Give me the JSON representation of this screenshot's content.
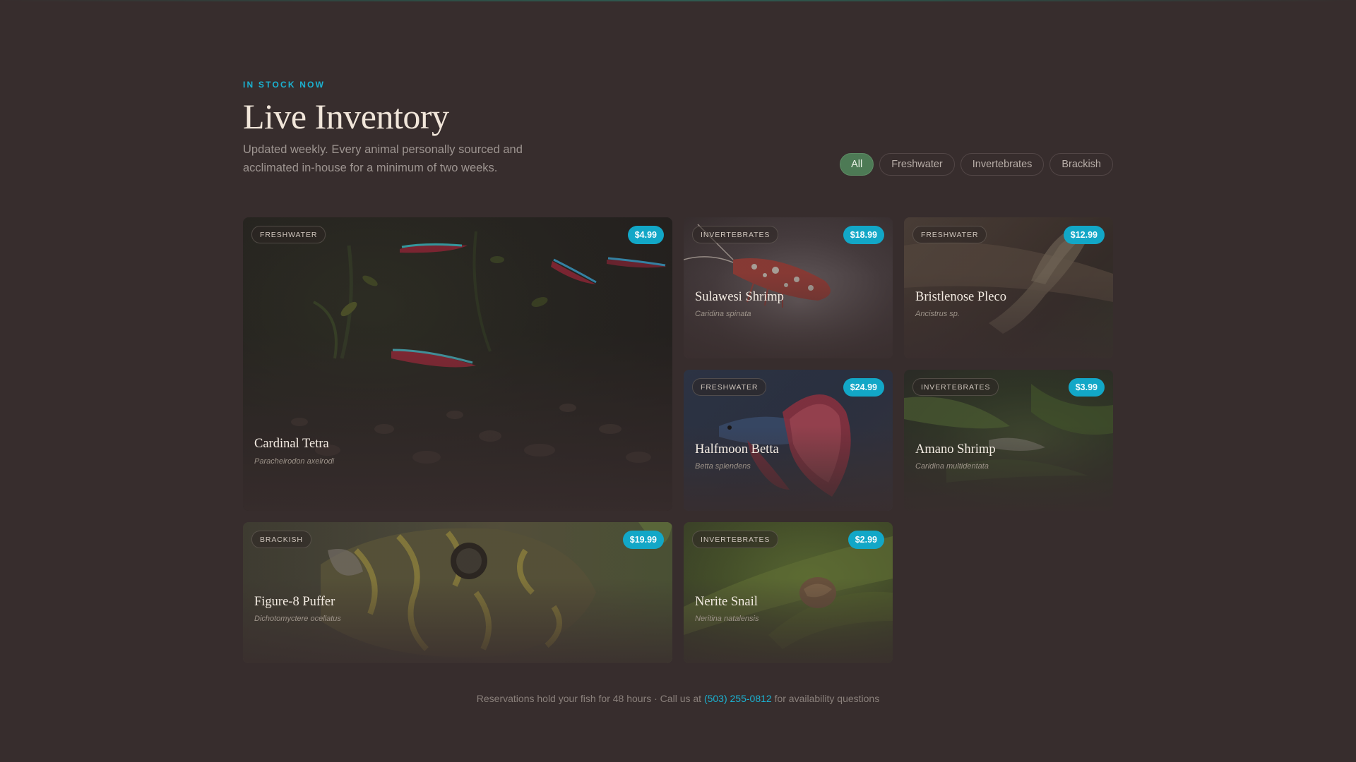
{
  "section": {
    "eyebrow": "IN STOCK NOW",
    "title": "Live Inventory",
    "subtitle": "Updated weekly. Every animal personally sourced and acclimated in-house for a minimum of two weeks."
  },
  "filters": [
    "All",
    "Freshwater",
    "Invertebrates",
    "Brackish"
  ],
  "active_filter": "All",
  "products": [
    {
      "category": "FRESHWATER",
      "price": "$4.99",
      "name": "Cardinal Tetra",
      "scientific": "Paracheirodon axelrodi",
      "icon": "tetra-fish"
    },
    {
      "category": "INVERTEBRATES",
      "price": "$18.99",
      "name": "Sulawesi Shrimp",
      "scientific": "Caridina spinata",
      "icon": "shrimp"
    },
    {
      "category": "FRESHWATER",
      "price": "$12.99",
      "name": "Bristlenose Pleco",
      "scientific": "Ancistrus sp.",
      "icon": "pleco"
    },
    {
      "category": "FRESHWATER",
      "price": "$24.99",
      "name": "Halfmoon Betta",
      "scientific": "Betta splendens",
      "icon": "betta-fish"
    },
    {
      "category": "INVERTEBRATES",
      "price": "$3.99",
      "name": "Amano Shrimp",
      "scientific": "Caridina multidentata",
      "icon": "shrimp"
    },
    {
      "category": "BRACKISH",
      "price": "$19.99",
      "name": "Figure-8 Puffer",
      "scientific": "Dichotomyctere ocellatus",
      "icon": "puffer-fish"
    },
    {
      "category": "INVERTEBRATES",
      "price": "$2.99",
      "name": "Nerite Snail",
      "scientific": "Neritina natalensis",
      "icon": "snail"
    }
  ],
  "footer": {
    "text_before": "Reservations hold your fish for 48 hours · Call us at",
    "phone": "(503) 255-0812",
    "text_after": "for availability questions"
  },
  "colors": {
    "background": "#372d2d",
    "accent": "#1bb1d0",
    "active_filter": "#4d7a55",
    "price_badge": "#12a7c7"
  }
}
